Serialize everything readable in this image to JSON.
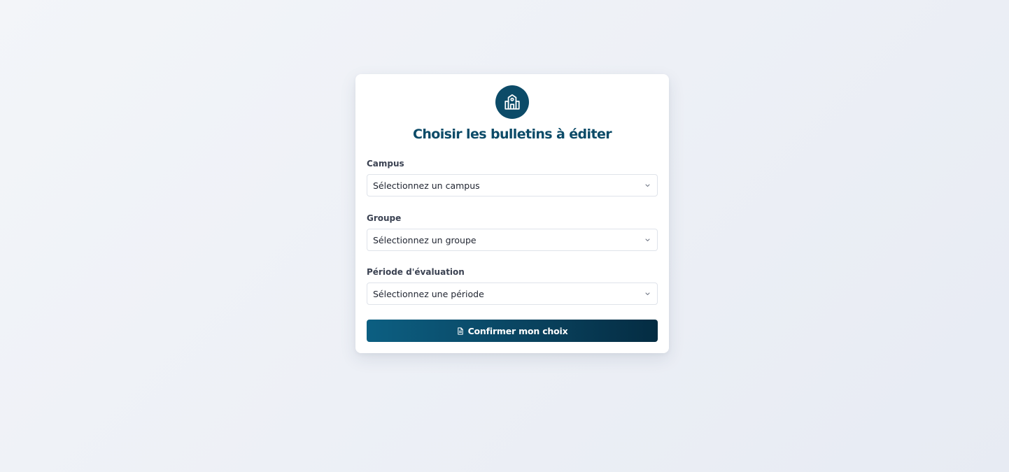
{
  "form": {
    "title": "Choisir les bulletins à éditer",
    "logo_icon": "school-building-icon",
    "campus": {
      "label": "Campus",
      "placeholder": "Sélectionnez un campus"
    },
    "groupe": {
      "label": "Groupe",
      "placeholder": "Sélectionnez un groupe"
    },
    "periode": {
      "label": "Période d'évaluation",
      "placeholder": "Sélectionnez une période"
    },
    "submit": {
      "label": "Confirmer mon choix",
      "icon": "document-icon"
    }
  },
  "colors": {
    "primary": "#0c4b68",
    "button_gradient_start": "#0c5f82",
    "button_gradient_end": "#042c42",
    "page_background": "#eef1f7"
  }
}
